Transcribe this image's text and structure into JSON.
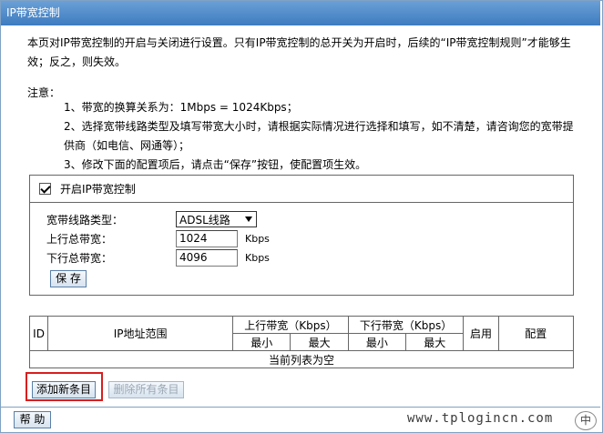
{
  "title": "IP带宽控制",
  "description": "本页对IP带宽控制的开启与关闭进行设置。只有IP带宽控制的总开关为开启时，后续的“IP带宽控制规则”才能够生效；反之，则失效。",
  "notes": {
    "title": "注意：",
    "items": [
      "1、带宽的换算关系为：1Mbps = 1024Kbps；",
      "2、选择宽带线路类型及填写带宽大小时，请根据实际情况进行选择和填写，如不清楚，请咨询您的宽带提供商（如电信、网通等）；",
      "3、修改下面的配置项后，请点击“保存”按钮，使配置项生效。"
    ]
  },
  "settings": {
    "enable_label": "开启IP带宽控制",
    "enable_checked": true,
    "line_type_label": "宽带线路类型：",
    "line_type_value": "ADSL线路",
    "upload_label": "上行总带宽：",
    "upload_value": "1024",
    "upload_unit": "Kbps",
    "download_label": "下行总带宽：",
    "download_value": "4096",
    "download_unit": "Kbps",
    "save_label": "保 存"
  },
  "table": {
    "col_id": "ID",
    "col_ip_range": "IP地址范围",
    "col_upload": "上行带宽（Kbps）",
    "col_download": "下行带宽（Kbps）",
    "col_enable": "启用",
    "col_config": "配置",
    "sub_min": "最小",
    "sub_max": "最大",
    "empty_text": "当前列表为空"
  },
  "buttons": {
    "add_entry": "添加新条目",
    "delete_all": "删除所有条目",
    "help": "帮 助"
  },
  "watermark": {
    "text": "www.tplogincn.com",
    "badge": "中"
  },
  "colors": {
    "title_bar": "#4f8acb",
    "highlight": "#d81e1e"
  }
}
